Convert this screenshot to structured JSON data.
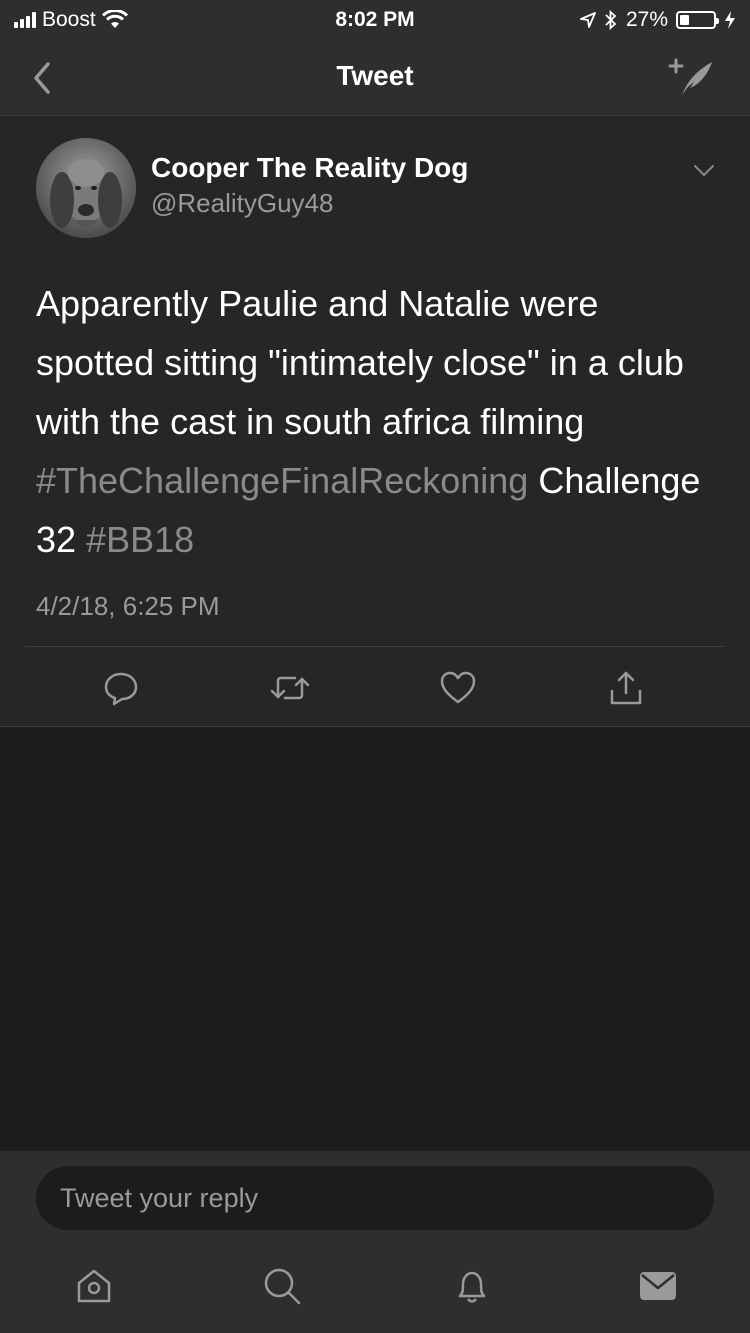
{
  "status_bar": {
    "carrier": "Boost",
    "time": "8:02 PM",
    "battery": "27%",
    "battery_level": 0.27
  },
  "nav": {
    "title": "Tweet"
  },
  "tweet": {
    "author_name": "Cooper The Reality Dog",
    "author_handle": "@RealityGuy48",
    "text_part1": "Apparently Paulie and Natalie were spotted  sitting \"intimately close\" in a club with the cast in south africa filming ",
    "hashtag1": "#TheChallengeFinalReckoning",
    "text_part2": " Challenge 32 ",
    "hashtag2": "#BB18",
    "timestamp": "4/2/18, 6:25 PM"
  },
  "reply": {
    "placeholder": "Tweet your reply"
  },
  "icons": {
    "back": "chevron-left-icon",
    "compose": "compose-tweet-icon",
    "reply": "comment-icon",
    "retweet": "retweet-icon",
    "like": "heart-icon",
    "share": "share-icon",
    "home": "home-icon",
    "search": "search-icon",
    "notifications": "bell-icon",
    "messages": "envelope-icon"
  },
  "colors": {
    "background": "#1c1c1c",
    "card": "#262626",
    "bar": "#2e2e2e",
    "hashtag": "#8a8a8a",
    "secondary_text": "#9a9a9a"
  }
}
